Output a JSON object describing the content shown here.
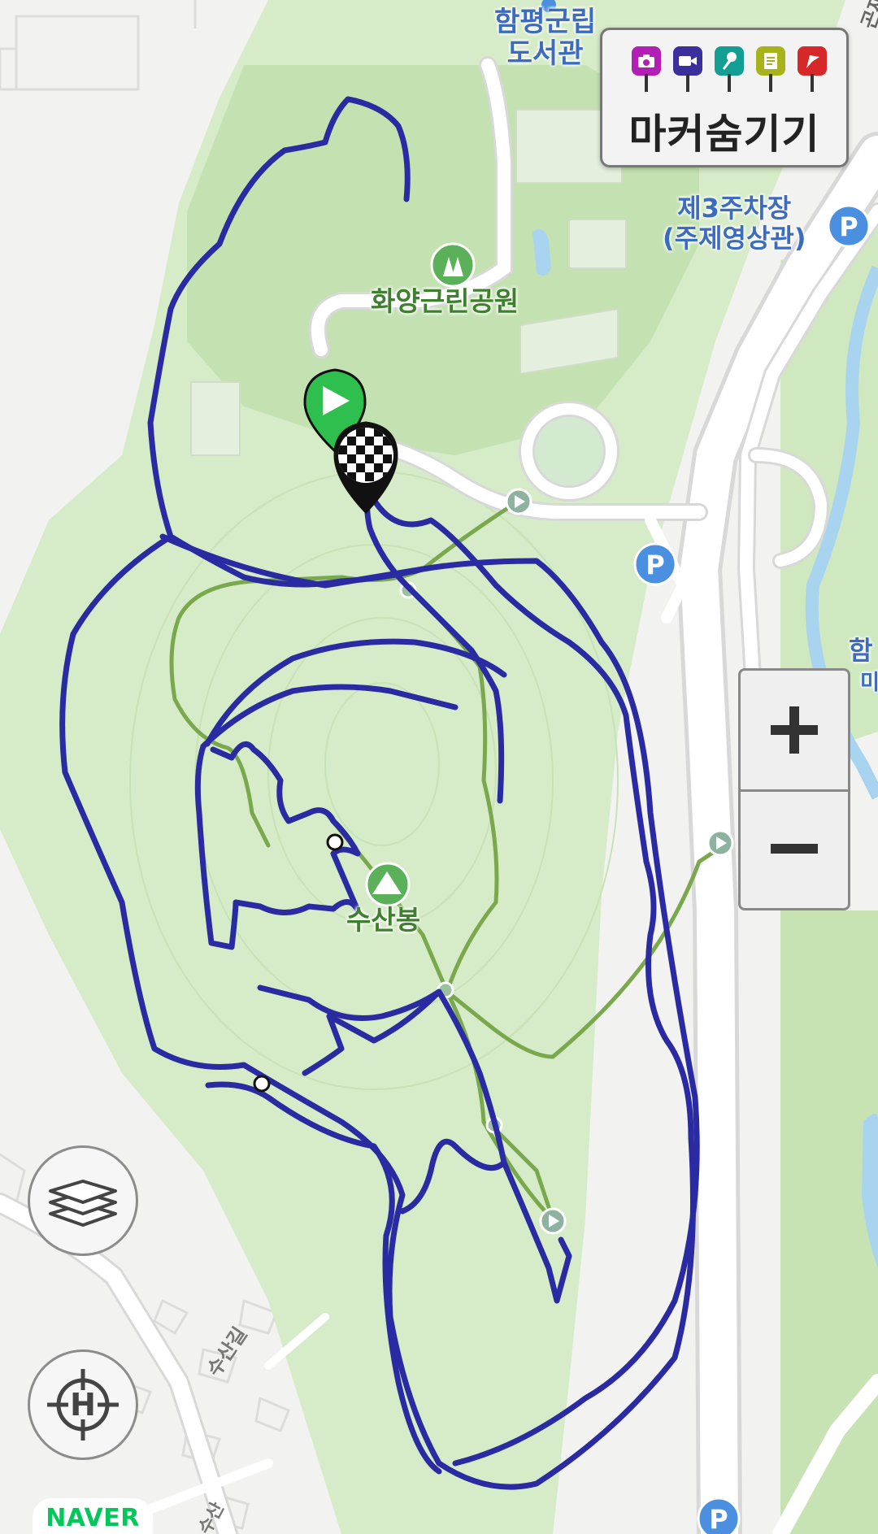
{
  "map": {
    "labels": {
      "library": "함평군립\n도서관",
      "parking3": "제3주차장\n(주제영상관)",
      "park": "화양근린공원",
      "peak": "수산봉",
      "road1": "수산길",
      "road2": "수산",
      "right_edge1": "함",
      "right_edge2": "미",
      "top_right_edge": "곤재로"
    },
    "colors": {
      "track": "#2a2ba3",
      "park_fill": "#cfe8bf",
      "park_dark": "#b9dda6",
      "trail": "#7aa84c",
      "road": "#ffffff",
      "water": "#a8d4f0",
      "parking": "#4a8fe0",
      "start_marker": "#2fbf4f"
    }
  },
  "marker_panel": {
    "label": "마커숨기기",
    "icons": [
      {
        "name": "camera-icon",
        "color": "#b21fb5"
      },
      {
        "name": "video-icon",
        "color": "#3a2f9c"
      },
      {
        "name": "microphone-icon",
        "color": "#129e93"
      },
      {
        "name": "memo-icon",
        "color": "#a8b21b"
      },
      {
        "name": "flag-icon",
        "color": "#d62828"
      }
    ]
  },
  "zoom": {
    "in_symbol": "+",
    "out_symbol": "−"
  },
  "brand": "NAVER"
}
